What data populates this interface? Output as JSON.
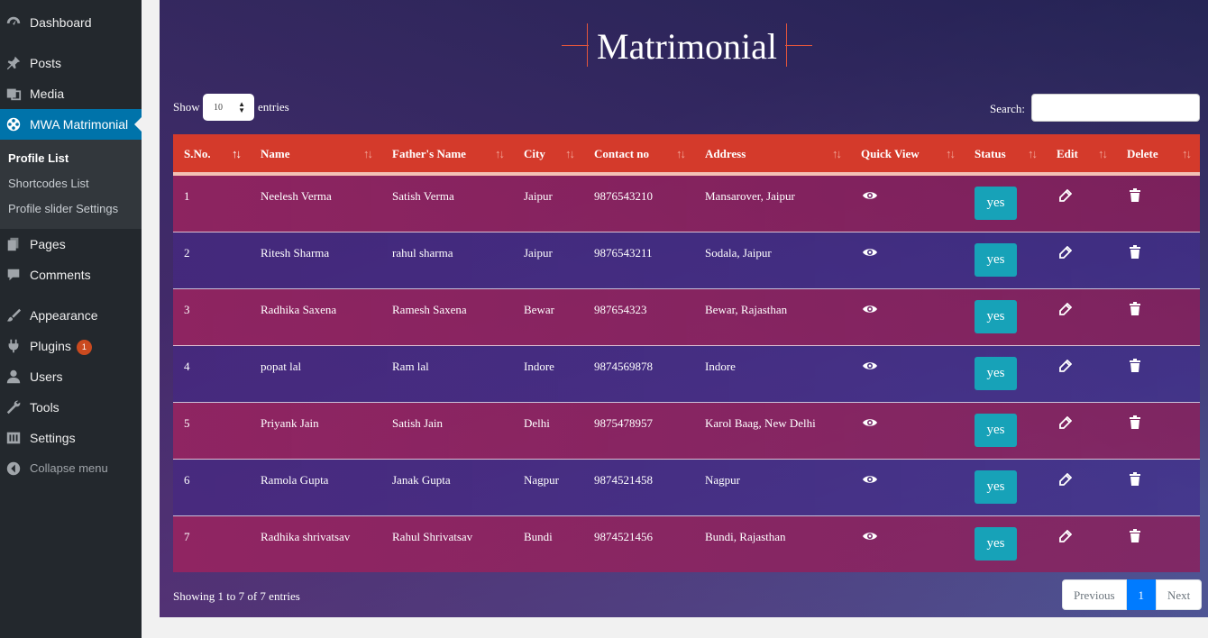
{
  "sidebar": {
    "items": [
      {
        "label": "Dashboard",
        "icon": "dashboard-icon"
      },
      {
        "label": "Posts",
        "icon": "pin-icon"
      },
      {
        "label": "Media",
        "icon": "media-icon"
      },
      {
        "label": "MWA Matrimonial",
        "icon": "film-reel-icon",
        "active": true
      },
      {
        "label": "Pages",
        "icon": "pages-icon"
      },
      {
        "label": "Comments",
        "icon": "comment-icon"
      },
      {
        "label": "Appearance",
        "icon": "brush-icon"
      },
      {
        "label": "Plugins",
        "icon": "plug-icon",
        "badge": "1"
      },
      {
        "label": "Users",
        "icon": "user-icon"
      },
      {
        "label": "Tools",
        "icon": "wrench-icon"
      },
      {
        "label": "Settings",
        "icon": "settings-icon"
      },
      {
        "label": "Collapse menu",
        "icon": "collapse-icon"
      }
    ],
    "submenu": [
      "Profile List",
      "Shortcodes List",
      "Profile slider Settings"
    ]
  },
  "page": {
    "title": "Matrimonial",
    "show_label": "Show",
    "length_value": "10",
    "entries_label": "entries",
    "search_label": "Search:",
    "search_value": ""
  },
  "table": {
    "headers": [
      "S.No.",
      "Name",
      "Father's Name",
      "City",
      "Contact no",
      "Address",
      "Quick View",
      "Status",
      "Edit",
      "Delete"
    ],
    "rows": [
      {
        "sno": "1",
        "name": "Neelesh Verma",
        "father": "Satish Verma",
        "city": "Jaipur",
        "contact": "9876543210",
        "address": "Mansarover, Jaipur",
        "status": "yes"
      },
      {
        "sno": "2",
        "name": "Ritesh Sharma",
        "father": "rahul sharma",
        "city": "Jaipur",
        "contact": "9876543211",
        "address": "Sodala, Jaipur",
        "status": "yes"
      },
      {
        "sno": "3",
        "name": "Radhika Saxena",
        "father": "Ramesh Saxena",
        "city": "Bewar",
        "contact": "987654323",
        "address": "Bewar, Rajasthan",
        "status": "yes"
      },
      {
        "sno": "4",
        "name": "popat lal",
        "father": "Ram lal",
        "city": "Indore",
        "contact": "9874569878",
        "address": "Indore",
        "status": "yes"
      },
      {
        "sno": "5",
        "name": "Priyank Jain",
        "father": "Satish Jain",
        "city": "Delhi",
        "contact": "9875478957",
        "address": "Karol Baag, New Delhi",
        "status": "yes"
      },
      {
        "sno": "6",
        "name": "Ramola Gupta",
        "father": "Janak Gupta",
        "city": "Nagpur",
        "contact": "9874521458",
        "address": "Nagpur",
        "status": "yes"
      },
      {
        "sno": "7",
        "name": "Radhika shrivatsav",
        "father": "Rahul Shrivatsav",
        "city": "Bundi",
        "contact": "9874521456",
        "address": "Bundi, Rajasthan",
        "status": "yes"
      }
    ]
  },
  "footer": {
    "info": "Showing 1 to 7 of 7 entries",
    "previous": "Previous",
    "current_page": "1",
    "next": "Next"
  },
  "colors": {
    "header_red": "#d43a2b",
    "status_teal": "#17a2b8",
    "wp_blue": "#0073aa",
    "pager_blue": "#007bff"
  }
}
